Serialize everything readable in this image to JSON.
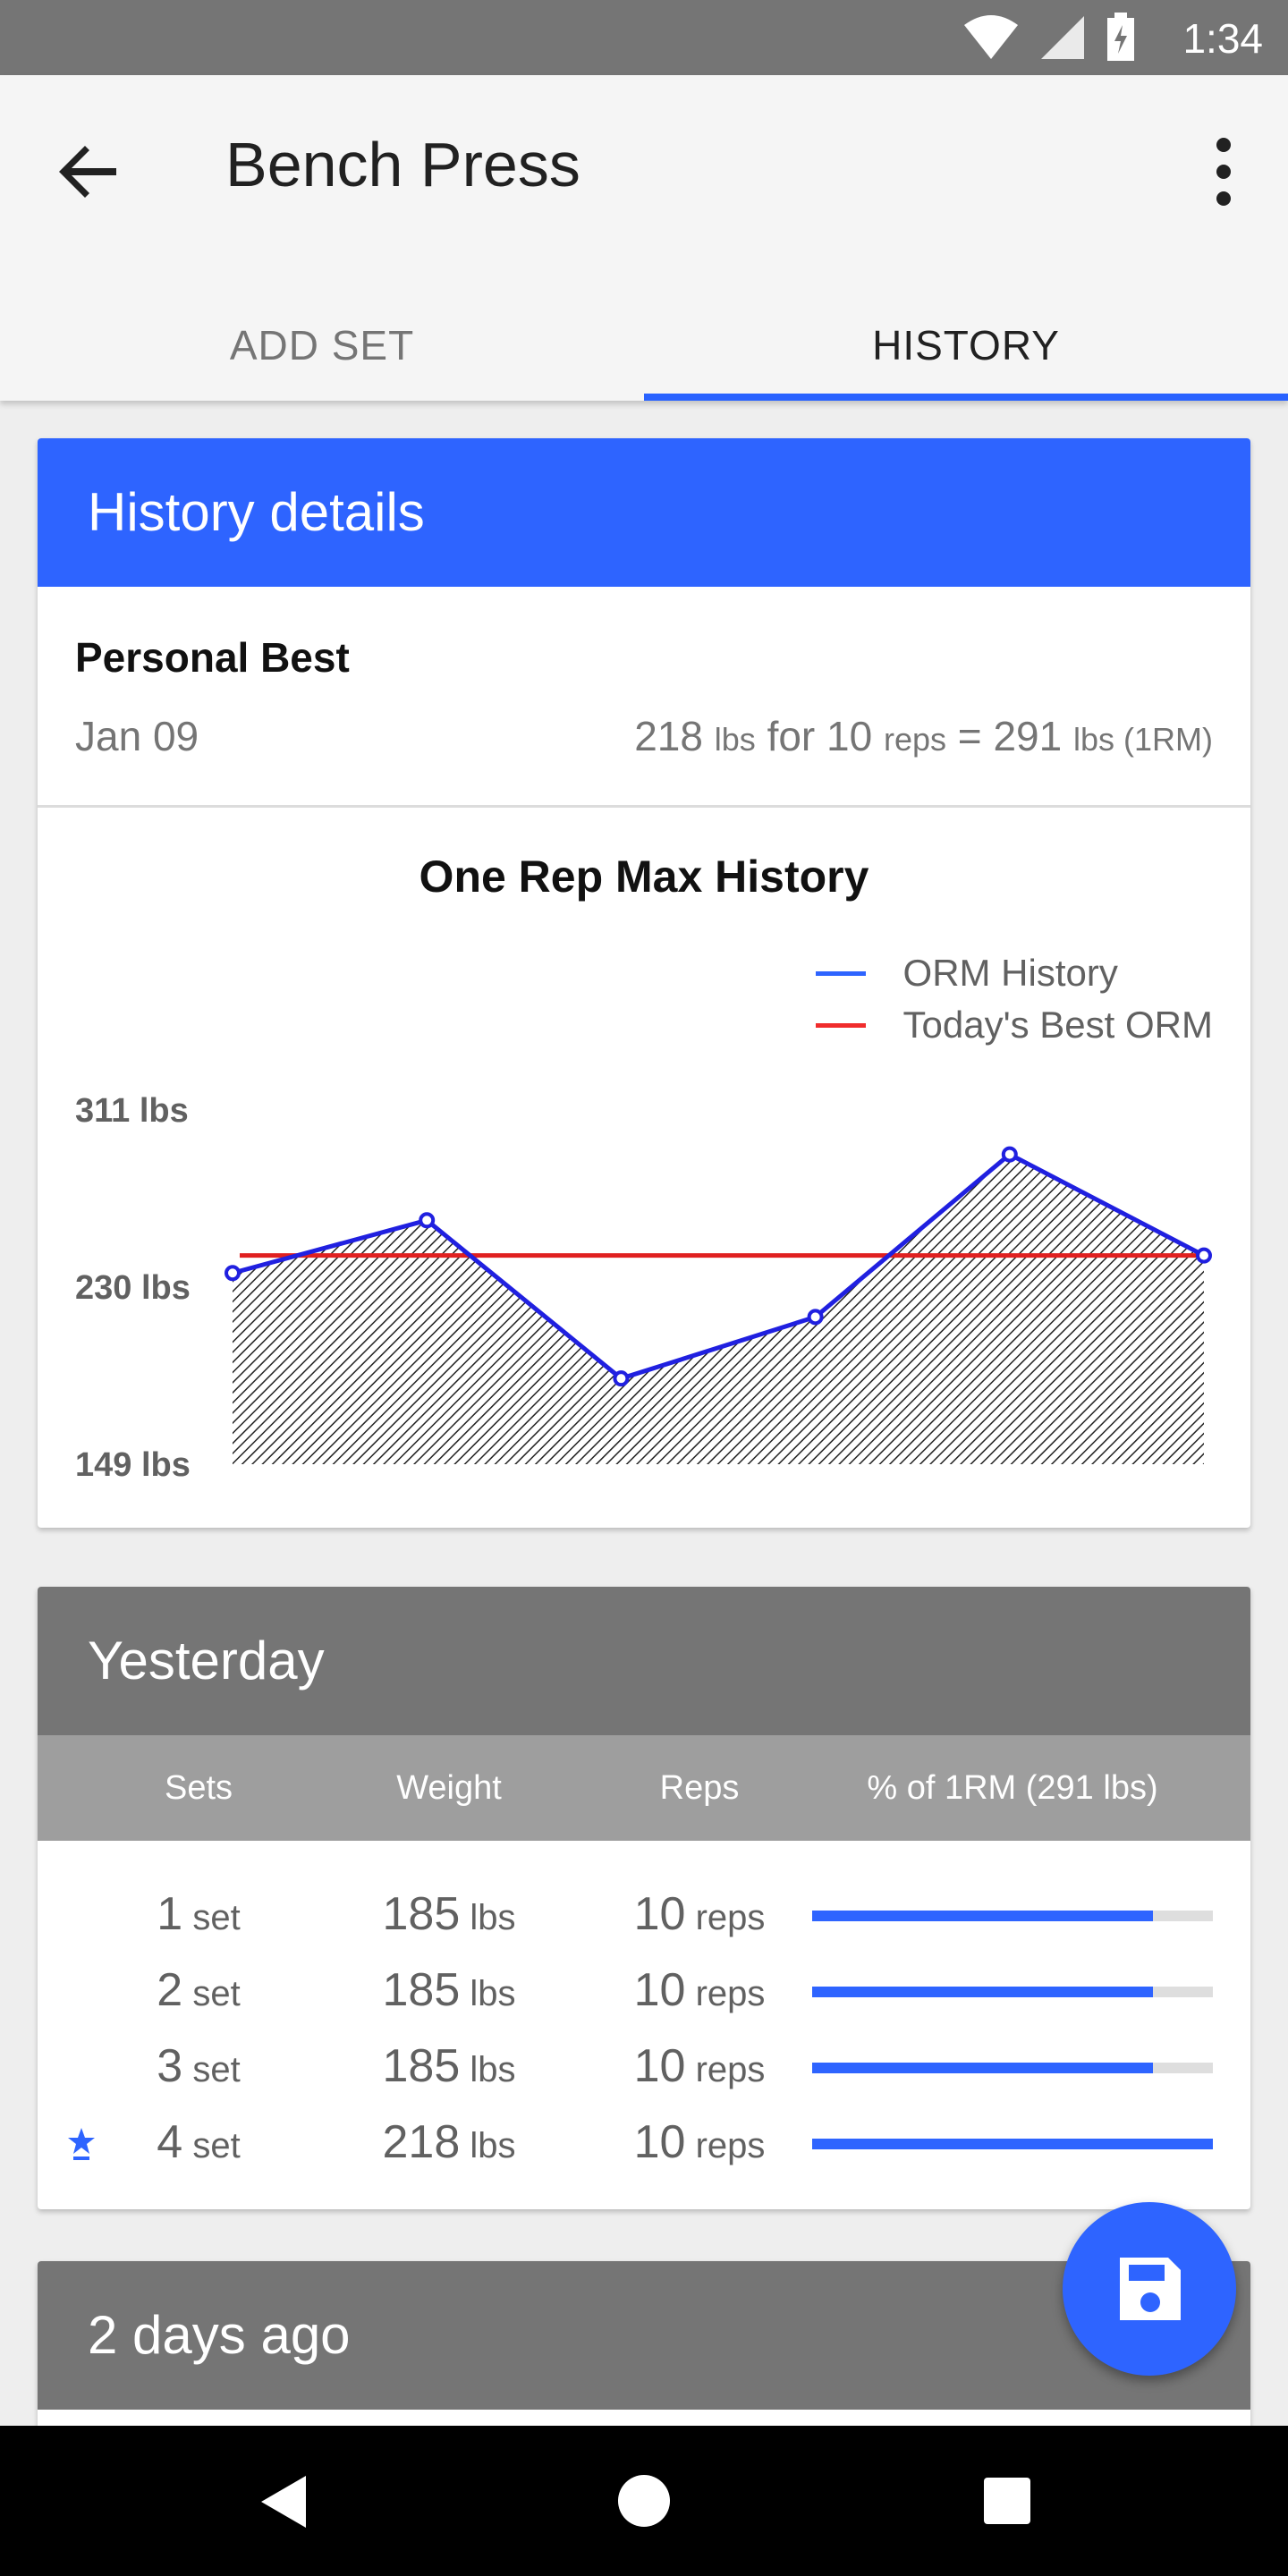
{
  "status_bar": {
    "time": "1:34",
    "icons": [
      "wifi-icon",
      "signal-icon",
      "battery-icon"
    ]
  },
  "app_bar": {
    "title": "Bench Press",
    "back_icon": "arrow-back-icon",
    "menu_icon": "more-vert-icon"
  },
  "tabs": [
    {
      "label": "ADD SET",
      "selected": false
    },
    {
      "label": "HISTORY",
      "selected": true
    }
  ],
  "history_details": {
    "header": "History details",
    "personal_best": {
      "label": "Personal Best",
      "date": "Jan 09",
      "weight": "218",
      "weight_unit": "lbs",
      "for_text": "for",
      "reps": "10",
      "reps_unit": "reps",
      "equals": "=",
      "orm": "291",
      "orm_unit": "lbs (1RM)"
    }
  },
  "chart_data": {
    "type": "area",
    "title": "One Rep Max History",
    "legend": [
      "ORM History",
      "Today's Best ORM"
    ],
    "legend_placement": "top-right",
    "y_tick_labels": [
      "311 lbs",
      "230 lbs",
      "149 lbs"
    ],
    "ylim": [
      149,
      311
    ],
    "series": [
      {
        "name": "ORM History",
        "values": [
          236,
          260,
          188,
          216,
          290,
          244
        ]
      },
      {
        "name": "Today's Best ORM",
        "values": [
          244,
          244,
          244,
          244,
          244,
          244
        ]
      }
    ],
    "colors": {
      "orm": "#2020e0",
      "best": "#e02020"
    }
  },
  "sessions": [
    {
      "header": "Yesterday",
      "columns": [
        "Sets",
        "Weight",
        "Reps",
        "% of 1RM (291 lbs)"
      ],
      "rows": [
        {
          "best": false,
          "set": "1",
          "set_unit": "set",
          "weight": "185",
          "weight_unit": "lbs",
          "reps": "10",
          "reps_unit": "reps",
          "pct": 0.85
        },
        {
          "best": false,
          "set": "2",
          "set_unit": "set",
          "weight": "185",
          "weight_unit": "lbs",
          "reps": "10",
          "reps_unit": "reps",
          "pct": 0.85
        },
        {
          "best": false,
          "set": "3",
          "set_unit": "set",
          "weight": "185",
          "weight_unit": "lbs",
          "reps": "10",
          "reps_unit": "reps",
          "pct": 0.85
        },
        {
          "best": true,
          "set": "4",
          "set_unit": "set",
          "weight": "218",
          "weight_unit": "lbs",
          "reps": "10",
          "reps_unit": "reps",
          "pct": 1.0
        }
      ]
    },
    {
      "header": "2 days ago"
    }
  ],
  "fab": {
    "icon": "save-icon"
  },
  "nav_bar": {
    "icons": [
      "nav-back-icon",
      "nav-home-icon",
      "nav-recents-icon"
    ]
  }
}
